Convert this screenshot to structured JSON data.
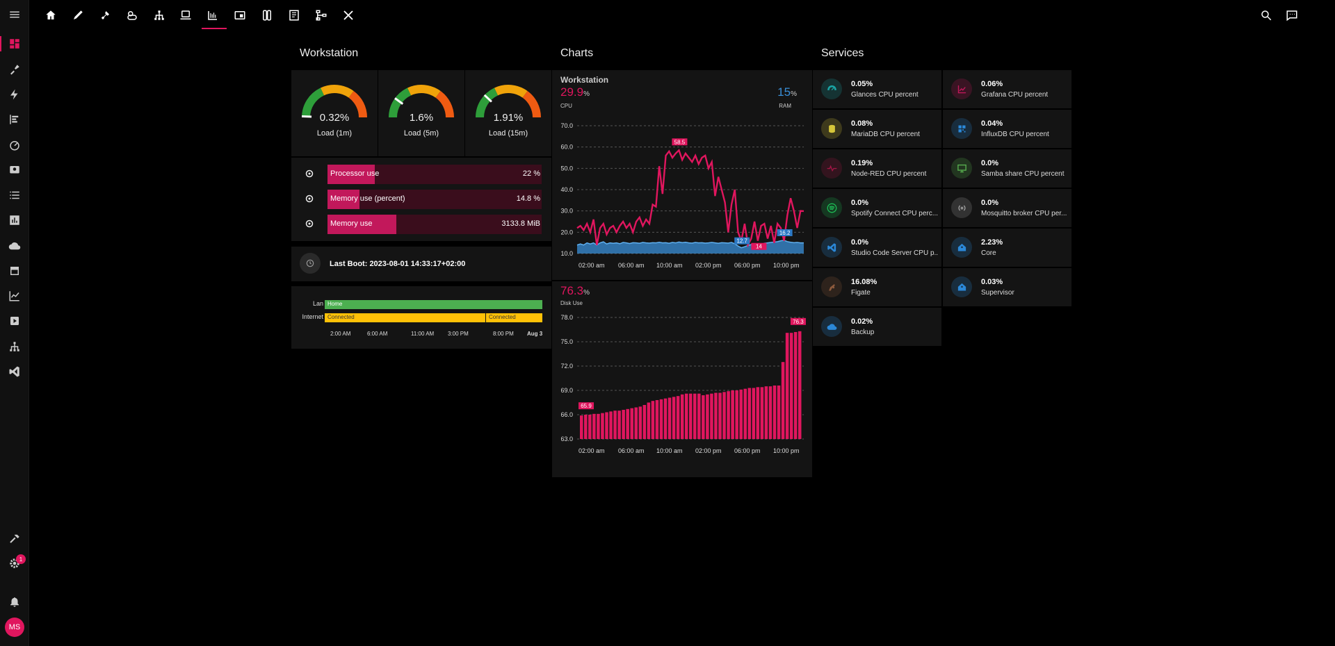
{
  "sidebar": {
    "badge_count": "1",
    "avatar_initials": "MS",
    "items": [
      "menu-icon",
      "dashboard-icon",
      "tools-icon",
      "lightning-icon",
      "list-chart-icon",
      "gauge-icon",
      "badge-icon",
      "list-icon",
      "bar-chart-icon",
      "cloud-icon",
      "calendar-icon",
      "line-chart-icon",
      "media-icon",
      "network-icon",
      "vscode-icon"
    ]
  },
  "topbar": {
    "icons": [
      "home-icon",
      "rocket-icon",
      "plug-icon",
      "weather-icon",
      "network-icon",
      "laptop-icon",
      "meter-icon",
      "cast-icon",
      "switch-icon",
      "book-icon",
      "tree-icon",
      "wrench-icon"
    ]
  },
  "workstation": {
    "title": "Workstation",
    "gauges": [
      {
        "value": "0.32%",
        "label": "Load (1m)",
        "level": 0.0032
      },
      {
        "value": "1.6%",
        "label": "Load (5m)",
        "level": 0.016
      },
      {
        "value": "1.91%",
        "label": "Load (15m)",
        "level": 0.0191
      }
    ],
    "bars": [
      {
        "label": "Processor use",
        "value": "22 %",
        "fraction": 0.22
      },
      {
        "label": "Memory use (percent)",
        "value": "14.8 %",
        "fraction": 0.148
      },
      {
        "label": "Memory use",
        "value": "3133.8 MiB",
        "fraction": 0.32
      }
    ],
    "last_boot": "Last Boot: 2023-08-01 14:33:17+02:00",
    "timeline": {
      "rows": [
        {
          "label": "Lan",
          "segments": [
            {
              "text": "Home",
              "color": "#4caf50"
            }
          ]
        },
        {
          "label": "Internet",
          "segments": [
            {
              "text": "Connected",
              "color": "#ffc107"
            },
            {
              "text": "Connected",
              "color": "#ffc107"
            }
          ]
        }
      ],
      "ticks": [
        "2:00 AM",
        "6:00 AM",
        "11:00 AM",
        "3:00 PM",
        "8:00 PM",
        "Aug 3"
      ]
    }
  },
  "charts": {
    "title": "Charts",
    "cpu_card": {
      "name": "Workstation",
      "cpu_value": "29.9",
      "cpu_unit": "%",
      "cpu_label": "CPU",
      "ram_value": "15",
      "ram_unit": "%",
      "ram_label": "RAM",
      "annotations": {
        "max": "58.5",
        "ram_min": "12.7",
        "ram_last": "16.2",
        "cpu_min": "14"
      }
    },
    "disk_card": {
      "value": "76.3",
      "unit": "%",
      "label": "Disk Use",
      "annotations": {
        "min": "65.9",
        "max": "76.3"
      }
    }
  },
  "chart_data": [
    {
      "type": "line",
      "ylim": [
        10,
        70
      ],
      "yticks": [
        "70.0",
        "60.0",
        "50.0",
        "40.0",
        "30.0",
        "20.0",
        "10.0"
      ],
      "xticks": [
        "02:00 am",
        "06:00 am",
        "10:00 am",
        "02:00 pm",
        "06:00 pm",
        "10:00 pm"
      ],
      "series": [
        {
          "name": "CPU",
          "color": "#e0165e",
          "values": [
            22,
            23,
            21,
            24,
            20,
            26,
            14,
            22,
            24,
            19,
            22,
            23,
            20,
            23,
            25,
            22,
            24,
            20,
            25,
            27,
            23,
            26,
            24,
            33,
            32,
            51,
            38,
            56,
            58,
            55,
            57,
            58.5,
            54,
            57,
            55,
            53,
            56,
            52,
            55,
            56,
            50,
            53,
            37,
            46,
            40,
            34,
            20,
            33,
            40,
            20,
            16,
            24,
            14,
            17,
            25,
            16,
            23,
            24,
            17,
            23,
            15,
            24,
            22,
            16,
            28,
            36,
            30,
            22,
            30,
            29.9
          ]
        },
        {
          "name": "RAM",
          "color": "#3a8fd8",
          "values": [
            14,
            14.5,
            14,
            15,
            14.5,
            15,
            14,
            15,
            15.5,
            14.5,
            15,
            14.8,
            15,
            14.6,
            15.2,
            15,
            14.7,
            15.1,
            15,
            14.8,
            15.2,
            15,
            14.9,
            15.1,
            15,
            15.3,
            15,
            15.1,
            14.8,
            15.2,
            15,
            15.4,
            15.1,
            15.3,
            15,
            14.9,
            15.2,
            15,
            15.1,
            14.9,
            15,
            15.2,
            15,
            14.8,
            15.1,
            15,
            14.9,
            15.2,
            14.6,
            13.5,
            12.7,
            13.2,
            13.8,
            14.2,
            14.6,
            14.5,
            14.3,
            14.8,
            15,
            15.2,
            15.4,
            15.6,
            16,
            16.2,
            15.6,
            15.3,
            15.1,
            15.2,
            15,
            15
          ]
        }
      ]
    },
    {
      "type": "bar",
      "ylim": [
        63,
        78
      ],
      "yticks": [
        "78.0",
        "75.0",
        "72.0",
        "69.0",
        "66.0",
        "63.0"
      ],
      "xticks": [
        "02:00 am",
        "06:00 am",
        "10:00 am",
        "02:00 pm",
        "06:00 pm",
        "10:00 pm"
      ],
      "series": [
        {
          "name": "Disk Use",
          "color": "#e0165e",
          "values": [
            65.9,
            66.0,
            66.0,
            66.1,
            66.1,
            66.2,
            66.3,
            66.4,
            66.5,
            66.5,
            66.6,
            66.7,
            66.8,
            66.9,
            67.0,
            67.2,
            67.5,
            67.7,
            67.8,
            67.9,
            68.0,
            68.1,
            68.2,
            68.3,
            68.5,
            68.6,
            68.6,
            68.6,
            68.6,
            68.4,
            68.5,
            68.6,
            68.7,
            68.7,
            68.8,
            68.9,
            69.0,
            69.0,
            69.1,
            69.2,
            69.3,
            69.3,
            69.4,
            69.4,
            69.5,
            69.5,
            69.6,
            69.6,
            72.5,
            76.1,
            76.1,
            76.2,
            76.3
          ]
        }
      ]
    }
  ],
  "services": {
    "title": "Services",
    "items": [
      {
        "value": "0.05%",
        "name": "Glances CPU percent",
        "icon": "gauge-icon",
        "color": "#1aa3a3"
      },
      {
        "value": "0.06%",
        "name": "Grafana CPU percent",
        "icon": "chart-line-icon",
        "color": "#c2185b"
      },
      {
        "value": "0.08%",
        "name": "MariaDB CPU percent",
        "icon": "database-icon",
        "color": "#d6c63a"
      },
      {
        "value": "0.04%",
        "name": "InfluxDB CPU percent",
        "icon": "qrcode-icon",
        "color": "#2b88d8"
      },
      {
        "value": "0.19%",
        "name": "Node-RED CPU percent",
        "icon": "pulse-icon",
        "color": "#a31545"
      },
      {
        "value": "0.0%",
        "name": "Samba share CPU percent",
        "icon": "monitor-share-icon",
        "color": "#58b04f"
      },
      {
        "value": "0.0%",
        "name": "Spotify Connect CPU perc...",
        "icon": "spotify-icon",
        "color": "#1db954"
      },
      {
        "value": "0.0%",
        "name": "Mosquitto broker CPU per...",
        "icon": "broadcast-icon",
        "color": "#9e9e9e"
      },
      {
        "value": "0.0%",
        "name": "Studio Code Server CPU p...",
        "icon": "vscode-icon",
        "color": "#2b88d8"
      },
      {
        "value": "2.23%",
        "name": "Core",
        "icon": "home-assistant-icon",
        "color": "#2b88d8"
      },
      {
        "value": "16.08%",
        "name": "Figate",
        "icon": "horse-icon",
        "color": "#8d5a3c"
      },
      {
        "value": "0.03%",
        "name": "Supervisor",
        "icon": "home-assistant-icon",
        "color": "#2b88d8"
      },
      {
        "value": "0.02%",
        "name": "Backup",
        "icon": "cloud-icon",
        "color": "#2b88d8"
      }
    ]
  }
}
